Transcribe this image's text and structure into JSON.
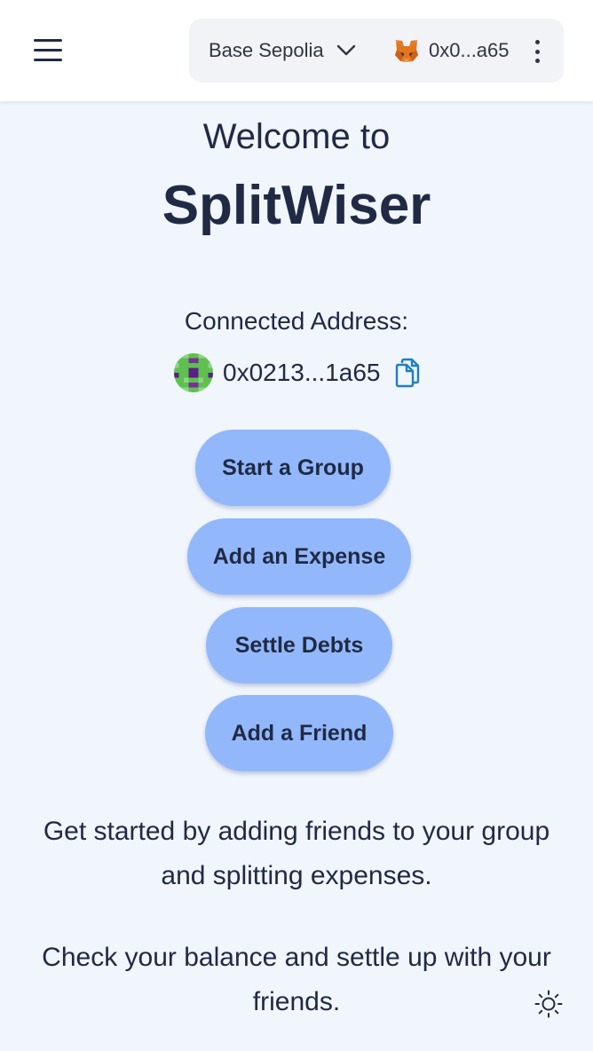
{
  "header": {
    "network_label": "Base Sepolia",
    "account_label": "0x0...a65"
  },
  "welcome": {
    "line1": "Welcome to",
    "app_name": "SplitWiser"
  },
  "connection": {
    "label": "Connected Address:",
    "address": "0x0213...1a65"
  },
  "actions": {
    "start_group": "Start a Group",
    "add_expense": "Add an Expense",
    "settle_debts": "Settle Debts",
    "add_friend": "Add a Friend"
  },
  "info": {
    "paragraph1": "Get started by adding friends to your group and splitting expenses.",
    "paragraph2": "Check your balance and settle up with your friends."
  },
  "colors": {
    "background": "#f1f5fc",
    "button": "#93b7fb",
    "text": "#202a44",
    "copy_icon": "#1f7ec4"
  },
  "icons": {
    "menu": "hamburger-menu-icon",
    "network_dropdown": "chevron-down-icon",
    "wallet": "metamask-fox-icon",
    "more": "kebab-menu-icon",
    "avatar": "blockie-avatar",
    "copy": "copy-icon",
    "theme": "sun-icon"
  }
}
